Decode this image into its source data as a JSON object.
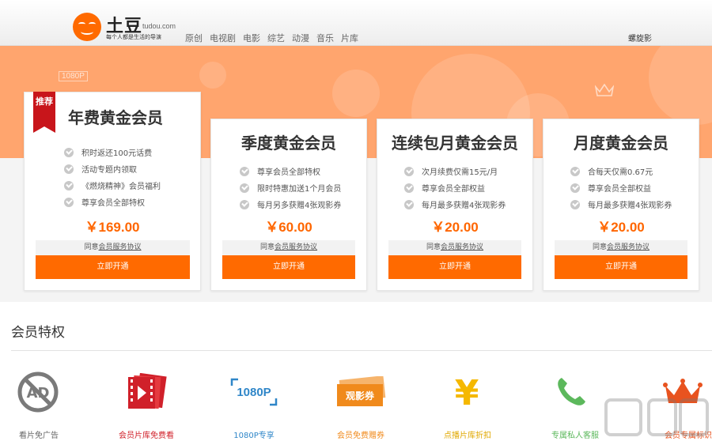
{
  "header": {
    "logo_name": "土豆",
    "logo_domain": "tudou.com",
    "logo_slogan": "每个人都是生活的导演",
    "nav": [
      "原创",
      "电视剧",
      "电影",
      "综艺",
      "动漫",
      "音乐",
      "片库"
    ],
    "user_link": "螺旋影"
  },
  "banner": {
    "hd_badge": "1080P"
  },
  "cards": [
    {
      "title": "年费黄金会员",
      "ribbon": "推荐",
      "features": [
        "积时返还100元话费",
        "活动专题内领取",
        "《燃烧精神》会员福利",
        "尊享会员全部特权"
      ],
      "price": "￥169.00",
      "agree_prefix": "同意",
      "agree_link": "会员服务协议",
      "button": "立即开通"
    },
    {
      "title": "季度黄金会员",
      "features": [
        "尊享会员全部特权",
        "限时特惠加送1个月会员",
        "每月另多获赠4张观影券"
      ],
      "price": "￥60.00",
      "agree_prefix": "同意",
      "agree_link": "会员服务协议",
      "button": "立即开通"
    },
    {
      "title": "连续包月黄金会员",
      "features": [
        "次月续费仅需15元/月",
        "尊享会员全部权益",
        "每月最多获赠4张观影券"
      ],
      "price": "￥20.00",
      "agree_prefix": "同意",
      "agree_link": "会员服务协议",
      "button": "立即开通"
    },
    {
      "title": "月度黄金会员",
      "features": [
        "合每天仅需0.67元",
        "尊享会员全部权益",
        "每月最多获赠4张观影券"
      ],
      "price": "￥20.00",
      "agree_prefix": "同意",
      "agree_link": "会员服务协议",
      "button": "立即开通"
    }
  ],
  "privileges": {
    "title": "会员特权",
    "items": [
      {
        "label": "看片免广告",
        "icon": "no-ad-icon",
        "color": "#666666",
        "icon_text": "AD"
      },
      {
        "label": "会员片库免费看",
        "icon": "film-library-icon",
        "color": "#d0202a"
      },
      {
        "label": "1080P专享",
        "icon": "1080p-icon",
        "color": "#2f86c8",
        "icon_text": "1080P"
      },
      {
        "label": "会员免费赠券",
        "icon": "ticket-icon",
        "color": "#f08a1c",
        "icon_text": "观影券"
      },
      {
        "label": "点播片库折扣",
        "icon": "yuan-discount-icon",
        "color": "#f5b800",
        "icon_text": "¥"
      },
      {
        "label": "专属私人客服",
        "icon": "phone-icon",
        "color": "#5cb85c"
      },
      {
        "label": "会员专属标识",
        "icon": "crown-icon",
        "color": "#e8531f"
      }
    ]
  },
  "colors": {
    "accent": "#ff6a00",
    "band": "#ffa56e",
    "ribbon": "#c8151b"
  }
}
